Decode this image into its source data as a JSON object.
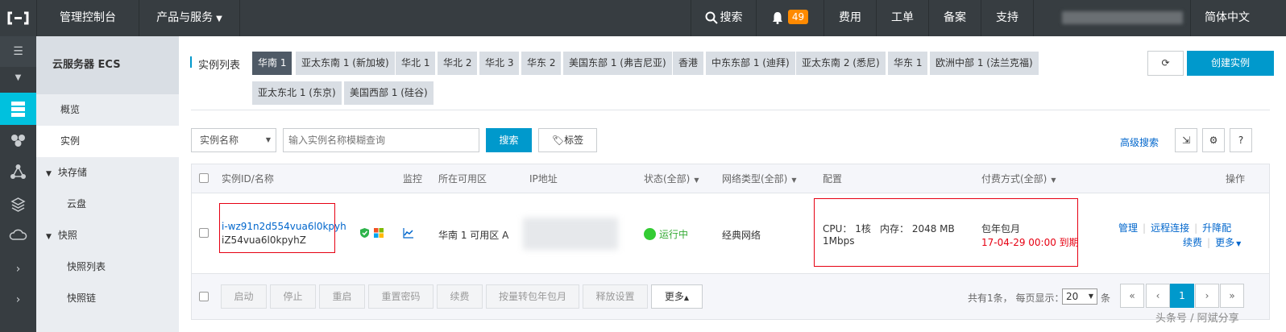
{
  "topbar": {
    "console": "管理控制台",
    "products": "产品与服务",
    "search": "搜索",
    "badge": "49",
    "fees": "费用",
    "ticket": "工单",
    "icp": "备案",
    "support": "支持",
    "language": "简体中文"
  },
  "sidebar": {
    "title": "云服务器 ECS",
    "overview": "概览",
    "instances": "实例",
    "block_storage": "块存储",
    "cloud_disk": "云盘",
    "snapshots": "快照",
    "snapshot_list": "快照列表",
    "snapshot_chain": "快照链"
  },
  "main": {
    "instance_list_label": "实例列表",
    "regions": [
      "华南 1",
      "亚太东南 1 (新加坡)",
      "华北 1",
      "华北 2",
      "华北 3",
      "华东 2",
      "美国东部 1 (弗吉尼亚)",
      "香港",
      "中东东部 1 (迪拜)",
      "亚太东南 2 (悉尼)",
      "华东 1",
      "欧洲中部 1 (法兰克福)"
    ],
    "regions_row2": [
      "亚太东北 1 (东京)",
      "美国西部 1 (硅谷)"
    ],
    "create_button": "创建实例",
    "filter_select": "实例名称",
    "search_placeholder": "输入实例名称模糊查询",
    "search_button": "搜索",
    "tag_button": "标签",
    "advanced_search": "高级搜索",
    "help": "?"
  },
  "table": {
    "headers": {
      "id_name": "实例ID/名称",
      "monitor": "监控",
      "zone": "所在可用区",
      "ip": "IP地址",
      "status": "状态(全部)",
      "network": "网络类型(全部)",
      "config": "配置",
      "billing": "付费方式(全部)",
      "actions": "操作"
    },
    "row": {
      "instance_id": "i-wz91n2d554vua6l0kpyh",
      "instance_name": "iZ54vua6l0kpyhZ",
      "zone": "华南 1 可用区 A",
      "status": "运行中",
      "network": "经典网络",
      "cpu": "CPU： 1核",
      "memory": "内存： 2048 MB",
      "bandwidth": "1Mbps",
      "billing_type": "包年包月",
      "expiry": "17-04-29 00:00 到期",
      "actions": {
        "manage": "管理",
        "remote": "远程连接",
        "upgrade": "升降配",
        "renew": "续费",
        "more": "更多"
      }
    }
  },
  "footer": {
    "buttons": [
      "启动",
      "停止",
      "重启",
      "重置密码",
      "续费",
      "按量转包年包月",
      "释放设置"
    ],
    "more": "更多",
    "summary": "共有1条， 每页显示：",
    "page_size": "20",
    "unit": "条",
    "pages": [
      "«",
      "‹",
      "1",
      "›",
      "»"
    ]
  },
  "watermark": "头条号 / 阿斌分享",
  "colors": {
    "accent": "#0099cc",
    "topbar": "#373d41",
    "running": "#33cc33",
    "alert": "#e60012"
  }
}
